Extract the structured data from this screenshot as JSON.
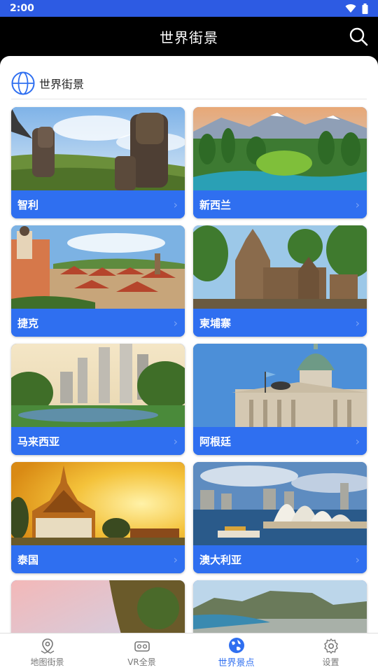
{
  "status_bar": {
    "time": "2:00"
  },
  "app_bar": {
    "title": "世界街景"
  },
  "section": {
    "title": "世界街景"
  },
  "countries": [
    {
      "label": "智利"
    },
    {
      "label": "新西兰"
    },
    {
      "label": "捷克"
    },
    {
      "label": "柬埔寨"
    },
    {
      "label": "马来西亚"
    },
    {
      "label": "阿根廷"
    },
    {
      "label": "泰国"
    },
    {
      "label": "澳大利亚"
    },
    {
      "label": ""
    },
    {
      "label": ""
    }
  ],
  "bottom_nav": [
    {
      "label": "地图街景",
      "icon": "map-pin-icon",
      "active": false
    },
    {
      "label": "VR全景",
      "icon": "vr-headset-icon",
      "active": false
    },
    {
      "label": "世界景点",
      "icon": "globe-icon",
      "active": true
    },
    {
      "label": "设置",
      "icon": "gear-icon",
      "active": false
    }
  ],
  "colors": {
    "status": "#2d5be3",
    "accent": "#2f6ff0",
    "app_bar": "#000000"
  }
}
